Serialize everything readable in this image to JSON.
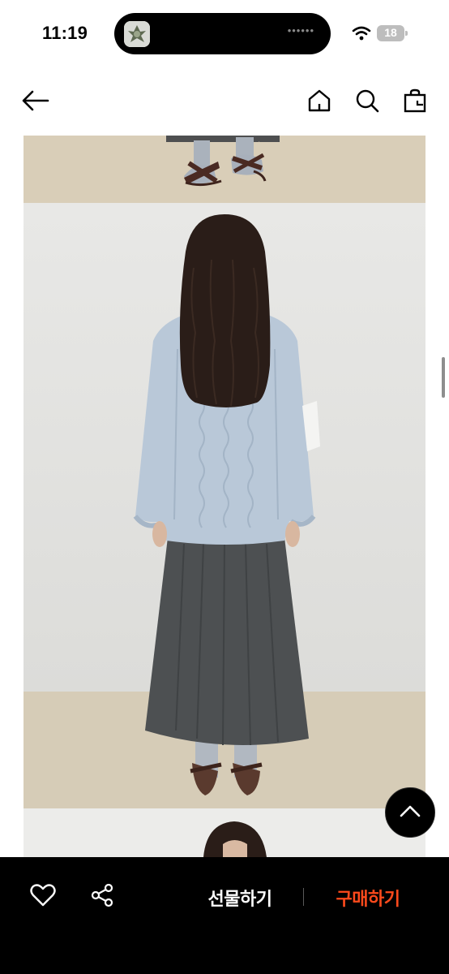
{
  "status_bar": {
    "time": "11:19",
    "island_dots": "••••••",
    "battery_level": "18"
  },
  "top_nav": {
    "back_icon": "arrow-left-icon",
    "home_icon": "home-icon",
    "search_icon": "search-icon",
    "cart_icon": "shopping-bag-icon"
  },
  "photos": {
    "top_image": "product-photo-feet",
    "main_image": "product-photo-back-view",
    "next_image": "product-photo-next"
  },
  "scroll_top_icon": "chevron-up-icon",
  "bottom_bar": {
    "like_icon": "heart-icon",
    "share_icon": "share-icon",
    "gift_label": "선물하기",
    "buy_label": "구매하기",
    "buy_color": "#ff4a1c"
  }
}
